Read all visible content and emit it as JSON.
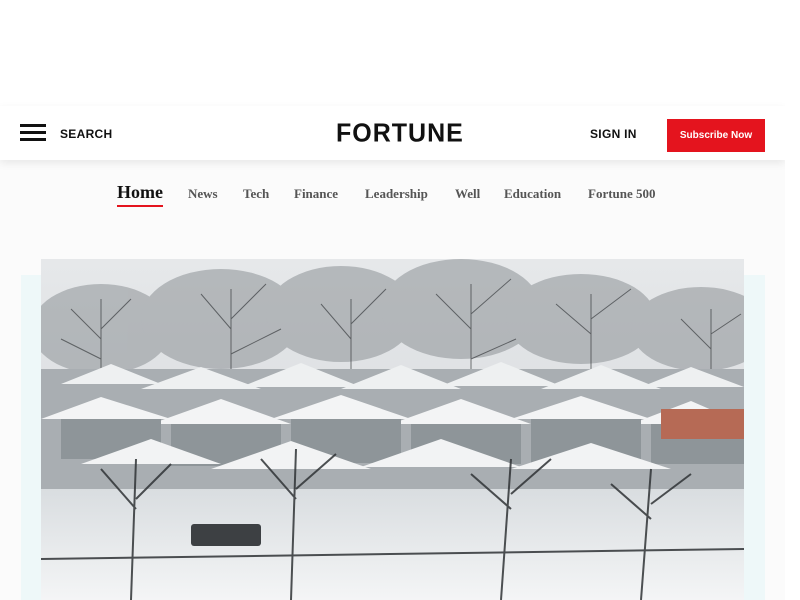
{
  "header": {
    "search_label": "SEARCH",
    "logo_text": "FORTUNE",
    "signin_label": "SIGN IN",
    "subscribe_label": "Subscribe Now",
    "accent_color": "#e4141e"
  },
  "nav": {
    "items": [
      {
        "label": "Home",
        "active": true
      },
      {
        "label": "News",
        "active": false
      },
      {
        "label": "Tech",
        "active": false
      },
      {
        "label": "Finance",
        "active": false
      },
      {
        "label": "Leadership",
        "active": false
      },
      {
        "label": "Well",
        "active": false
      },
      {
        "label": "Education",
        "active": false
      },
      {
        "label": "Fortune 500",
        "active": false
      }
    ]
  },
  "icons": {
    "menu": "hamburger-menu-icon"
  }
}
